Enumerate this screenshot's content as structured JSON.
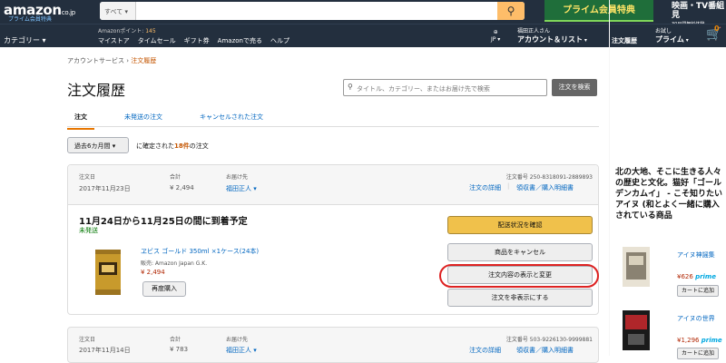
{
  "header": {
    "logo": "amazon",
    "logo_suffix": "co.jp",
    "logo_sub": "プライム会員特典",
    "search_category": "すべて",
    "prime_banner": "プライム会員特典",
    "video_banner_title": "映画・TV番組見",
    "video_banner_sub": "30日間無料体験",
    "category_menu": "カテゴリー",
    "points_label": "Amazonポイント:",
    "points_value": "145",
    "nav_links": [
      "マイストア",
      "タイムセール",
      "ギフト券",
      "Amazonで売る",
      "ヘルプ"
    ],
    "lang": "JP",
    "account_greeting": "福田正人さん",
    "account_label": "アカウント＆リスト",
    "orders_label": "注文履歴",
    "prime_top": "お試し",
    "prime_label": "プライム",
    "cart_count": "0"
  },
  "breadcrumb": {
    "parent": "アカウントサービス",
    "separator": "›",
    "current": "注文履歴"
  },
  "page": {
    "title": "注文履歴",
    "search_placeholder": "タイトル、カテゴリー、またはお届け先で検索",
    "search_button": "注文を検索",
    "tabs": [
      "注文",
      "未発送の注文",
      "キャンセルされた注文"
    ],
    "period_select": "過去6カ月間",
    "period_caption_pre": "に確定された",
    "period_caption_count": "18件",
    "period_caption_post": "の注文"
  },
  "order1": {
    "date_label": "注文日",
    "date": "2017年11月23日",
    "total_label": "合計",
    "total": "¥ 2,494",
    "ship_to_label": "お届け先",
    "ship_to": "福田正人",
    "order_no": "注文番号 250-8318091-2889893",
    "details_link": "注文の詳細",
    "receipt_link": "領収書／購入明細書",
    "delivery": "11月24日から11月25日の間に到着予定",
    "status": "未発送",
    "product_title": "ヱビス ゴールド 350ml ×1ケース(24本)",
    "seller": "販売: Amazon Japan G.K.",
    "price": "¥ 2,494",
    "rebuy_button": "再度購入",
    "btn_track": "配送状況を確認",
    "btn_cancel": "商品をキャンセル",
    "btn_view_change": "注文内容の表示と変更",
    "btn_hide": "注文を非表示にする"
  },
  "order2": {
    "date_label": "注文日",
    "date": "2017年11月14日",
    "total_label": "合計",
    "total": "¥ 783",
    "ship_to_label": "お届け先",
    "ship_to": "福田正人",
    "order_no": "注文番号 503-9226130-9999881",
    "details_link": "注文の詳細",
    "receipt_link": "領収書／購入明細書"
  },
  "right_panel": {
    "text": "北の大地、そこに生きる人々の歴史と文化。猫好「ゴールデンカムイ」 - こそ知りたいアイヌ (和とよく一緒に購入されている商品",
    "label": "商品",
    "item1_title": "アイヌ神謡集",
    "item1_price": "¥626",
    "item1_prime": "prime",
    "item1_btn": "カートに追加",
    "item2_title": "アイヌの世界",
    "item2_price": "¥1,296",
    "item2_prime": "prime",
    "item2_btn": "カートに追加"
  }
}
